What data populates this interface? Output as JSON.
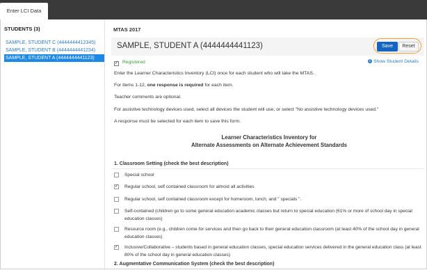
{
  "tabs": {
    "enter_lci": "Enter LCI Data"
  },
  "sidebar": {
    "heading": "STUDENTS (3)",
    "items": [
      {
        "label": "SAMPLE, STUDENT C (4444444412345)",
        "active": false
      },
      {
        "label": "SAMPLE, STUDENT B (4444444441234)",
        "active": false
      },
      {
        "label": "SAMPLE, STUDENT A (4444444441123)",
        "active": true
      }
    ]
  },
  "main": {
    "section_label": "MTAS 2017",
    "student_name": "SAMPLE, STUDENT A (4444444441123)",
    "save_label": "Save",
    "reset_label": "Reset",
    "registered_label": "Registered",
    "registered_checked": true,
    "show_details_label": "Show Student Details",
    "instructions": {
      "line1": "Enter the Learner Characteristics Inventory (LCI) once for each student who will take the MTAS.",
      "line2_pre": "For items 1-12, ",
      "line2_bold": "one response is required",
      "line2_post": " for each item.",
      "line3": "Teacher comments are optional.",
      "line4": "For assistive technology devices used, select all devices the student will use, or select \"No assistive technology devices used.\"",
      "line5": "A response must be selected for each item to save this form."
    },
    "form_title_1": "Learner Characteristics Inventory for",
    "form_title_2": "Alternate Assessments on Alternate Achievement Standards",
    "question1": {
      "label": "1. Classroom Setting (check the best description)",
      "options": [
        {
          "text": "Special school",
          "checked": false
        },
        {
          "text": "Regular school, self contained classroom for almost all activities",
          "checked": true
        },
        {
          "text": "Regular school, self contained classroom except for homeroom, lunch, and \" specials \".",
          "checked": false
        },
        {
          "text": "Self-contained (children go to some general education academic classes but return to special education (61% or more of school day in special education classes)",
          "checked": false
        },
        {
          "text": "Resource room (e.g., children come for services and then go back to their general education classroom (at least 40% of the school day in general education classes)",
          "checked": false
        },
        {
          "text": "Inclusive/Collaborative – students based in general education classes, special education services delivered in the general education class (at least 80% of the school day in general education classes)",
          "checked": true
        }
      ]
    },
    "question2": {
      "label": "2. Augmentative Communication System (check the best description)"
    }
  },
  "colors": {
    "accent": "#1e88e5",
    "save": "#1565c0",
    "highlight_ring": "#f0a23a",
    "registered": "#3c9a3c",
    "link": "#2e7cc2"
  }
}
